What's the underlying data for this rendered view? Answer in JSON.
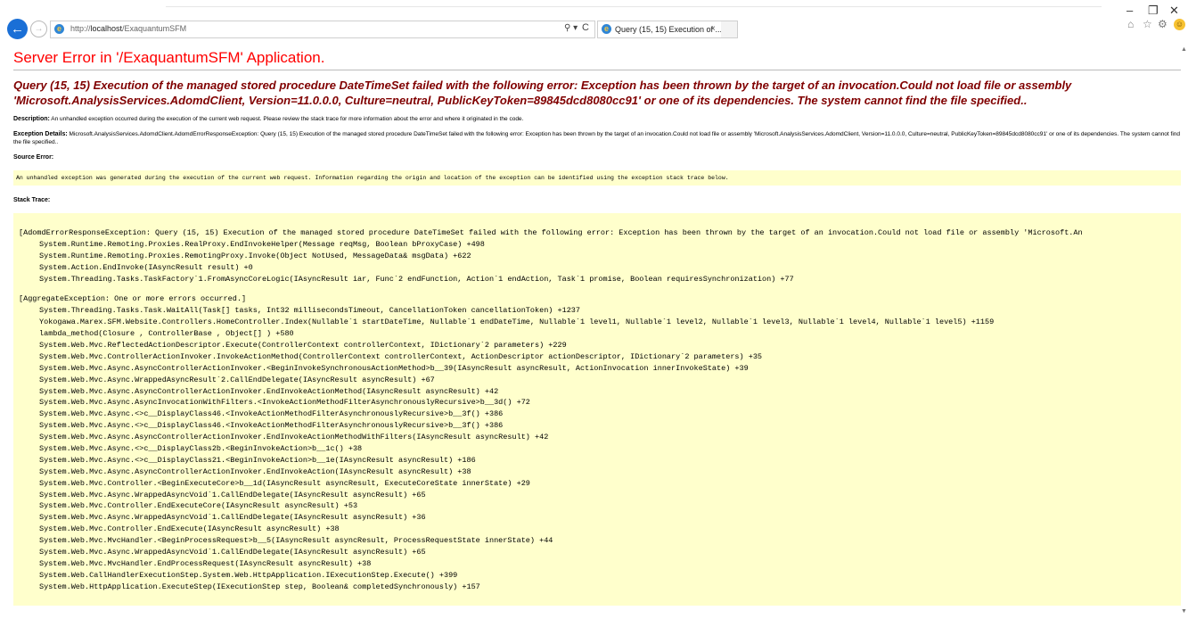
{
  "browser": {
    "url_prefix": "http://",
    "url_host": "localhost",
    "url_path": "/ExaquantumSFM",
    "search_glyph": "⚲",
    "search_caret": "▾",
    "refresh_glyph": "C",
    "tab_title": "Query (15, 15) Execution of ...",
    "tab_close": "×",
    "icons": [
      "back-arrow-icon",
      "forward-arrow-icon",
      "ie-logo-icon",
      "search-icon",
      "refresh-icon",
      "close-icon",
      "minimize-icon",
      "maximize-icon",
      "home-icon",
      "star-icon",
      "gear-icon",
      "smiley-icon"
    ],
    "window_controls": {
      "minimize": "–",
      "maximize": "❐",
      "close": "✕"
    },
    "toolbar": {
      "home": "⌂",
      "favorites": "☆",
      "settings": "⚙",
      "smiley": "☺"
    },
    "nav": {
      "back": "←",
      "forward": "→"
    }
  },
  "page": {
    "server_error_title": "Server Error in '/ExaquantumSFM' Application.",
    "error_heading": "Query (15, 15) Execution of the managed stored procedure DateTimeSet failed with the following error: Exception has been thrown by the target of an invocation.Could not load file or assembly 'Microsoft.AnalysisServices.AdomdClient, Version=11.0.0.0, Culture=neutral, PublicKeyToken=89845dcd8080cc91' or one of its dependencies. The system cannot find the file specified..",
    "description_label": "Description:",
    "description_text": " An unhandled exception occurred during the execution of the current web request. Please review the stack trace for more information about the error and where it originated in the code.",
    "exception_details_label": "Exception Details:",
    "exception_details_text": " Microsoft.AnalysisServices.AdomdClient.AdomdErrorResponseException: Query (15, 15) Execution of the managed stored procedure DateTimeSet failed with the following error: Exception has been thrown by the target of an invocation.Could not load file or assembly 'Microsoft.AnalysisServices.AdomdClient, Version=11.0.0.0, Culture=neutral, PublicKeyToken=89845dcd8080cc91' or one of its dependencies. The system cannot find the file specified..",
    "source_error_label": "Source Error:",
    "source_error_text": "An unhandled exception was generated during the execution of the current web request. Information regarding the origin and location of the exception can be identified using the exception stack trace below.",
    "stack_trace_label": "Stack Trace:",
    "colors": {
      "title_red": "#ff0000",
      "heading_maroon": "#800000",
      "code_background": "#ffffcc"
    }
  },
  "stack_trace": {
    "groups": [
      {
        "header": "[AdomdErrorResponseException: Query (15, 15) Execution of the managed stored procedure DateTimeSet failed with the following error: Exception has been thrown by the target of an invocation.Could not load file or assembly 'Microsoft.An",
        "lines": [
          "System.Runtime.Remoting.Proxies.RealProxy.EndInvokeHelper(Message reqMsg, Boolean bProxyCase) +498",
          "System.Runtime.Remoting.Proxies.RemotingProxy.Invoke(Object NotUsed, MessageData& msgData) +622",
          "System.Action.EndInvoke(IAsyncResult result) +0",
          "System.Threading.Tasks.TaskFactory`1.FromAsyncCoreLogic(IAsyncResult iar, Func`2 endFunction, Action`1 endAction, Task`1 promise, Boolean requiresSynchronization) +77"
        ]
      },
      {
        "header": "[AggregateException: One or more errors occurred.]",
        "lines": [
          "System.Threading.Tasks.Task.WaitAll(Task[] tasks, Int32 millisecondsTimeout, CancellationToken cancellationToken) +1237",
          "Yokogawa.Marex.SFM.Website.Controllers.HomeController.Index(Nullable`1 startDateTime, Nullable`1 endDateTime, Nullable`1 level1, Nullable`1 level2, Nullable`1 level3, Nullable`1 level4, Nullable`1 level5) +1159",
          "lambda_method(Closure , ControllerBase , Object[] ) +580",
          "System.Web.Mvc.ReflectedActionDescriptor.Execute(ControllerContext controllerContext, IDictionary`2 parameters) +229",
          "System.Web.Mvc.ControllerActionInvoker.InvokeActionMethod(ControllerContext controllerContext, ActionDescriptor actionDescriptor, IDictionary`2 parameters) +35",
          "System.Web.Mvc.Async.AsyncControllerActionInvoker.<BeginInvokeSynchronousActionMethod>b__39(IAsyncResult asyncResult, ActionInvocation innerInvokeState) +39",
          "System.Web.Mvc.Async.WrappedAsyncResult`2.CallEndDelegate(IAsyncResult asyncResult) +67",
          "System.Web.Mvc.Async.AsyncControllerActionInvoker.EndInvokeActionMethod(IAsyncResult asyncResult) +42",
          "System.Web.Mvc.Async.AsyncInvocationWithFilters.<InvokeActionMethodFilterAsynchronouslyRecursive>b__3d() +72",
          "System.Web.Mvc.Async.<>c__DisplayClass46.<InvokeActionMethodFilterAsynchronouslyRecursive>b__3f() +386",
          "System.Web.Mvc.Async.<>c__DisplayClass46.<InvokeActionMethodFilterAsynchronouslyRecursive>b__3f() +386",
          "System.Web.Mvc.Async.AsyncControllerActionInvoker.EndInvokeActionMethodWithFilters(IAsyncResult asyncResult) +42",
          "System.Web.Mvc.Async.<>c__DisplayClass2b.<BeginInvokeAction>b__1c() +38",
          "System.Web.Mvc.Async.<>c__DisplayClass21.<BeginInvokeAction>b__1e(IAsyncResult asyncResult) +186",
          "System.Web.Mvc.Async.AsyncControllerActionInvoker.EndInvokeAction(IAsyncResult asyncResult) +38",
          "System.Web.Mvc.Controller.<BeginExecuteCore>b__1d(IAsyncResult asyncResult, ExecuteCoreState innerState) +29",
          "System.Web.Mvc.Async.WrappedAsyncVoid`1.CallEndDelegate(IAsyncResult asyncResult) +65",
          "System.Web.Mvc.Controller.EndExecuteCore(IAsyncResult asyncResult) +53",
          "System.Web.Mvc.Async.WrappedAsyncVoid`1.CallEndDelegate(IAsyncResult asyncResult) +36",
          "System.Web.Mvc.Controller.EndExecute(IAsyncResult asyncResult) +38",
          "System.Web.Mvc.MvcHandler.<BeginProcessRequest>b__5(IAsyncResult asyncResult, ProcessRequestState innerState) +44",
          "System.Web.Mvc.Async.WrappedAsyncVoid`1.CallEndDelegate(IAsyncResult asyncResult) +65",
          "System.Web.Mvc.MvcHandler.EndProcessRequest(IAsyncResult asyncResult) +38",
          "System.Web.CallHandlerExecutionStep.System.Web.HttpApplication.IExecutionStep.Execute() +399",
          "System.Web.HttpApplication.ExecuteStep(IExecutionStep step, Boolean& completedSynchronously) +157"
        ]
      }
    ]
  }
}
